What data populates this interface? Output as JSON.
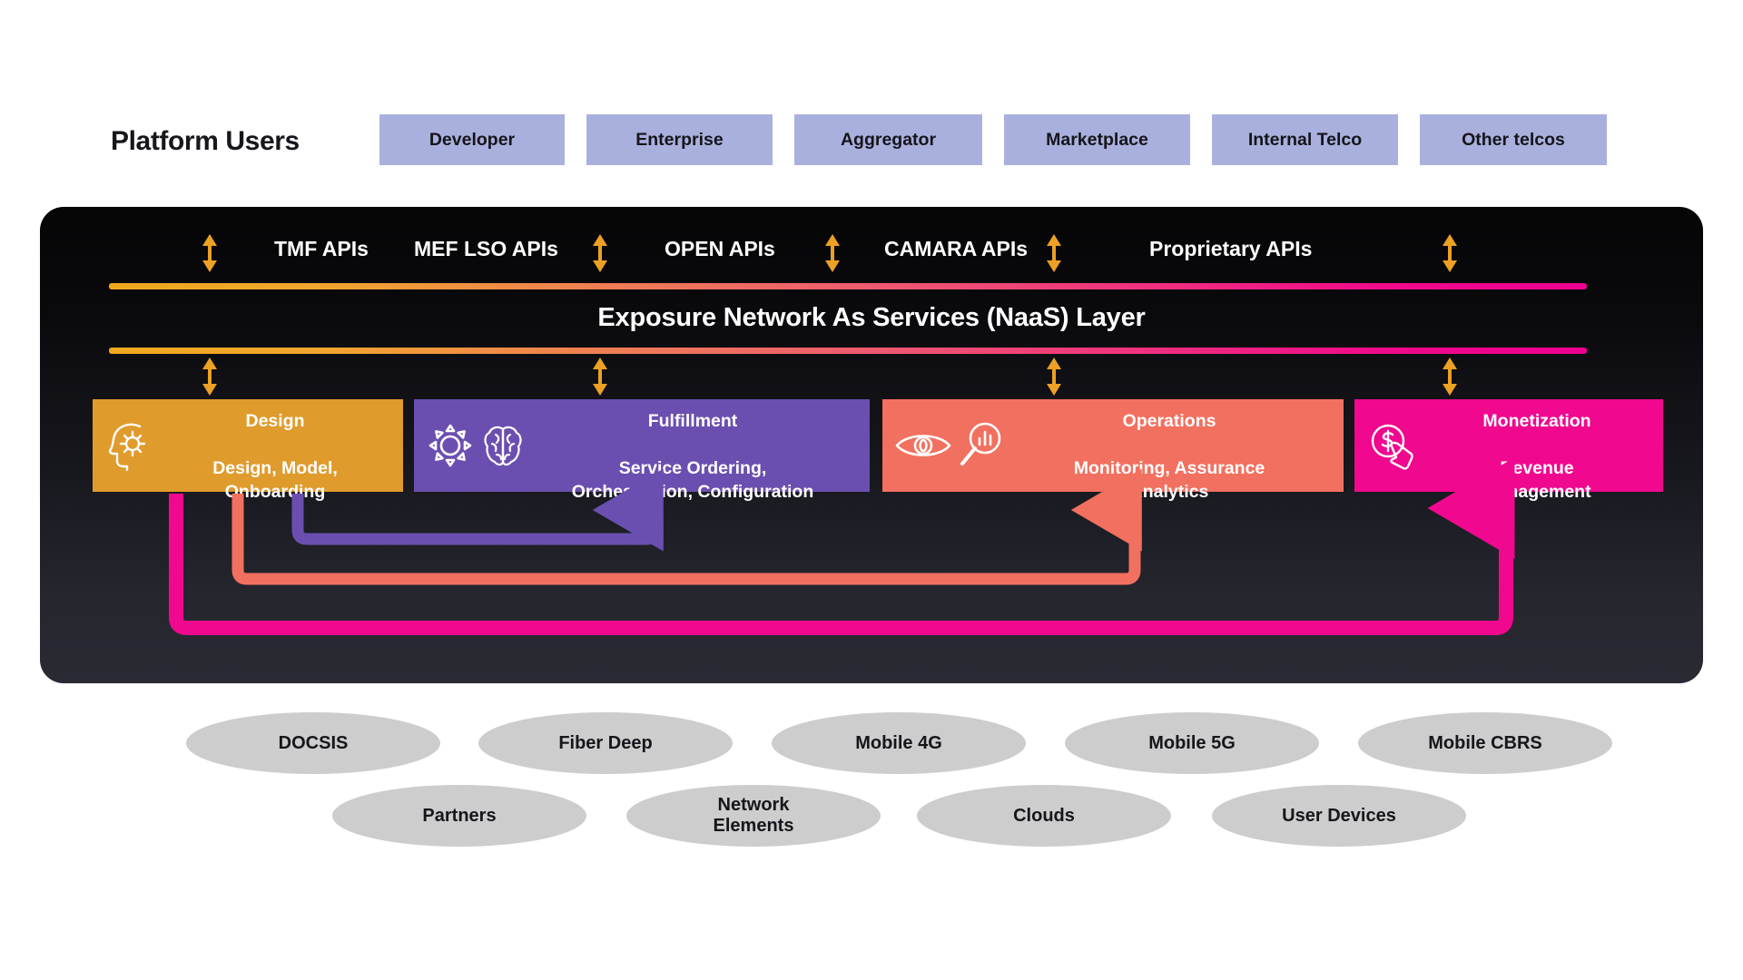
{
  "platform_users": {
    "title": "Platform Users",
    "boxes": [
      {
        "label": "Developer"
      },
      {
        "label": "Enterprise"
      },
      {
        "label": "Aggregator"
      },
      {
        "label": "Marketplace"
      },
      {
        "label": "Internal Telco"
      },
      {
        "label": "Other telcos"
      }
    ]
  },
  "apis": {
    "labels": [
      {
        "label": "TMF APIs"
      },
      {
        "label": "MEF LSO APIs"
      },
      {
        "label": "OPEN APIs"
      },
      {
        "label": "CAMARA APIs"
      },
      {
        "label": "Proprietary APIs"
      }
    ],
    "arrow_icon": "double-arrow-vertical-icon",
    "arrow_color": "#eca024"
  },
  "naas": {
    "title": "Exposure Network As Services (NaaS) Layer",
    "gradient_start": "#f0a81e",
    "gradient_end": "#ee0090"
  },
  "functions": [
    {
      "id": "design",
      "title": "Design",
      "subtitle": "Design, Model,\nOnboarding",
      "color": "#e09b2d",
      "icons": [
        "head-gear-icon"
      ]
    },
    {
      "id": "fulfillment",
      "title": "Fulfillment",
      "subtitle": "Service Ordering,\nOrchestration, Configuration",
      "color": "#6b4fb0",
      "icons": [
        "gear-icon",
        "brain-icon"
      ]
    },
    {
      "id": "operations",
      "title": "Operations",
      "subtitle": "Monitoring, Assurance\nAnalytics",
      "color": "#f2705f",
      "icons": [
        "eye-icon",
        "magnifier-chart-icon"
      ]
    },
    {
      "id": "monetization",
      "title": "Monetization",
      "subtitle": "Revenue\nManagement",
      "color": "#f0088f",
      "icons": [
        "dollar-click-icon"
      ]
    }
  ],
  "feedback_loops": [
    {
      "name": "fulfillment-feedback",
      "color": "#6b4fb0"
    },
    {
      "name": "operations-feedback",
      "color": "#f2705f"
    },
    {
      "name": "monetization-feedback",
      "color": "#f0088f"
    }
  ],
  "infrastructure": {
    "row1": [
      {
        "label": "DOCSIS"
      },
      {
        "label": "Fiber Deep"
      },
      {
        "label": "Mobile 4G"
      },
      {
        "label": "Mobile 5G"
      },
      {
        "label": "Mobile CBRS"
      }
    ],
    "row2": [
      {
        "label": "Partners"
      },
      {
        "label": "Network\nElements"
      },
      {
        "label": "Clouds"
      },
      {
        "label": "User Devices"
      }
    ],
    "fill_color": "#cdcdcd"
  },
  "panel": {
    "background_top": "#050506",
    "background_bottom": "#2a2a34"
  }
}
